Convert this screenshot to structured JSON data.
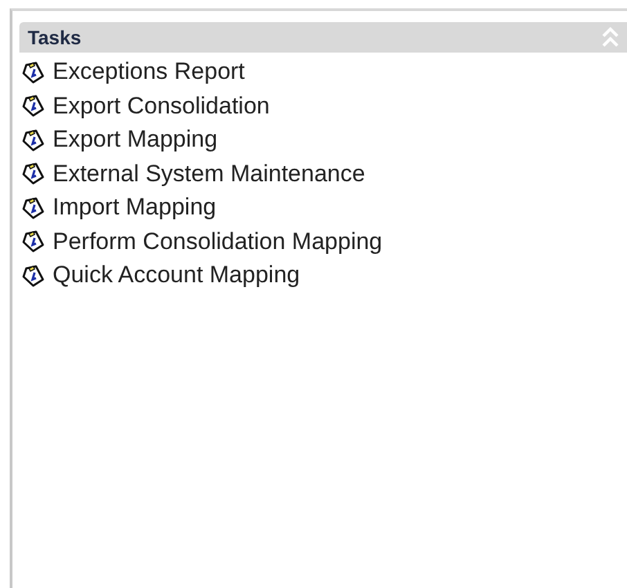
{
  "panel": {
    "title": "Tasks",
    "expanded": true
  },
  "tasks": [
    {
      "label": "Exceptions Report"
    },
    {
      "label": "Export Consolidation"
    },
    {
      "label": "Export Mapping"
    },
    {
      "label": "External System Maintenance"
    },
    {
      "label": "Import Mapping"
    },
    {
      "label": "Perform Consolidation Mapping"
    },
    {
      "label": "Quick Account Mapping"
    }
  ]
}
